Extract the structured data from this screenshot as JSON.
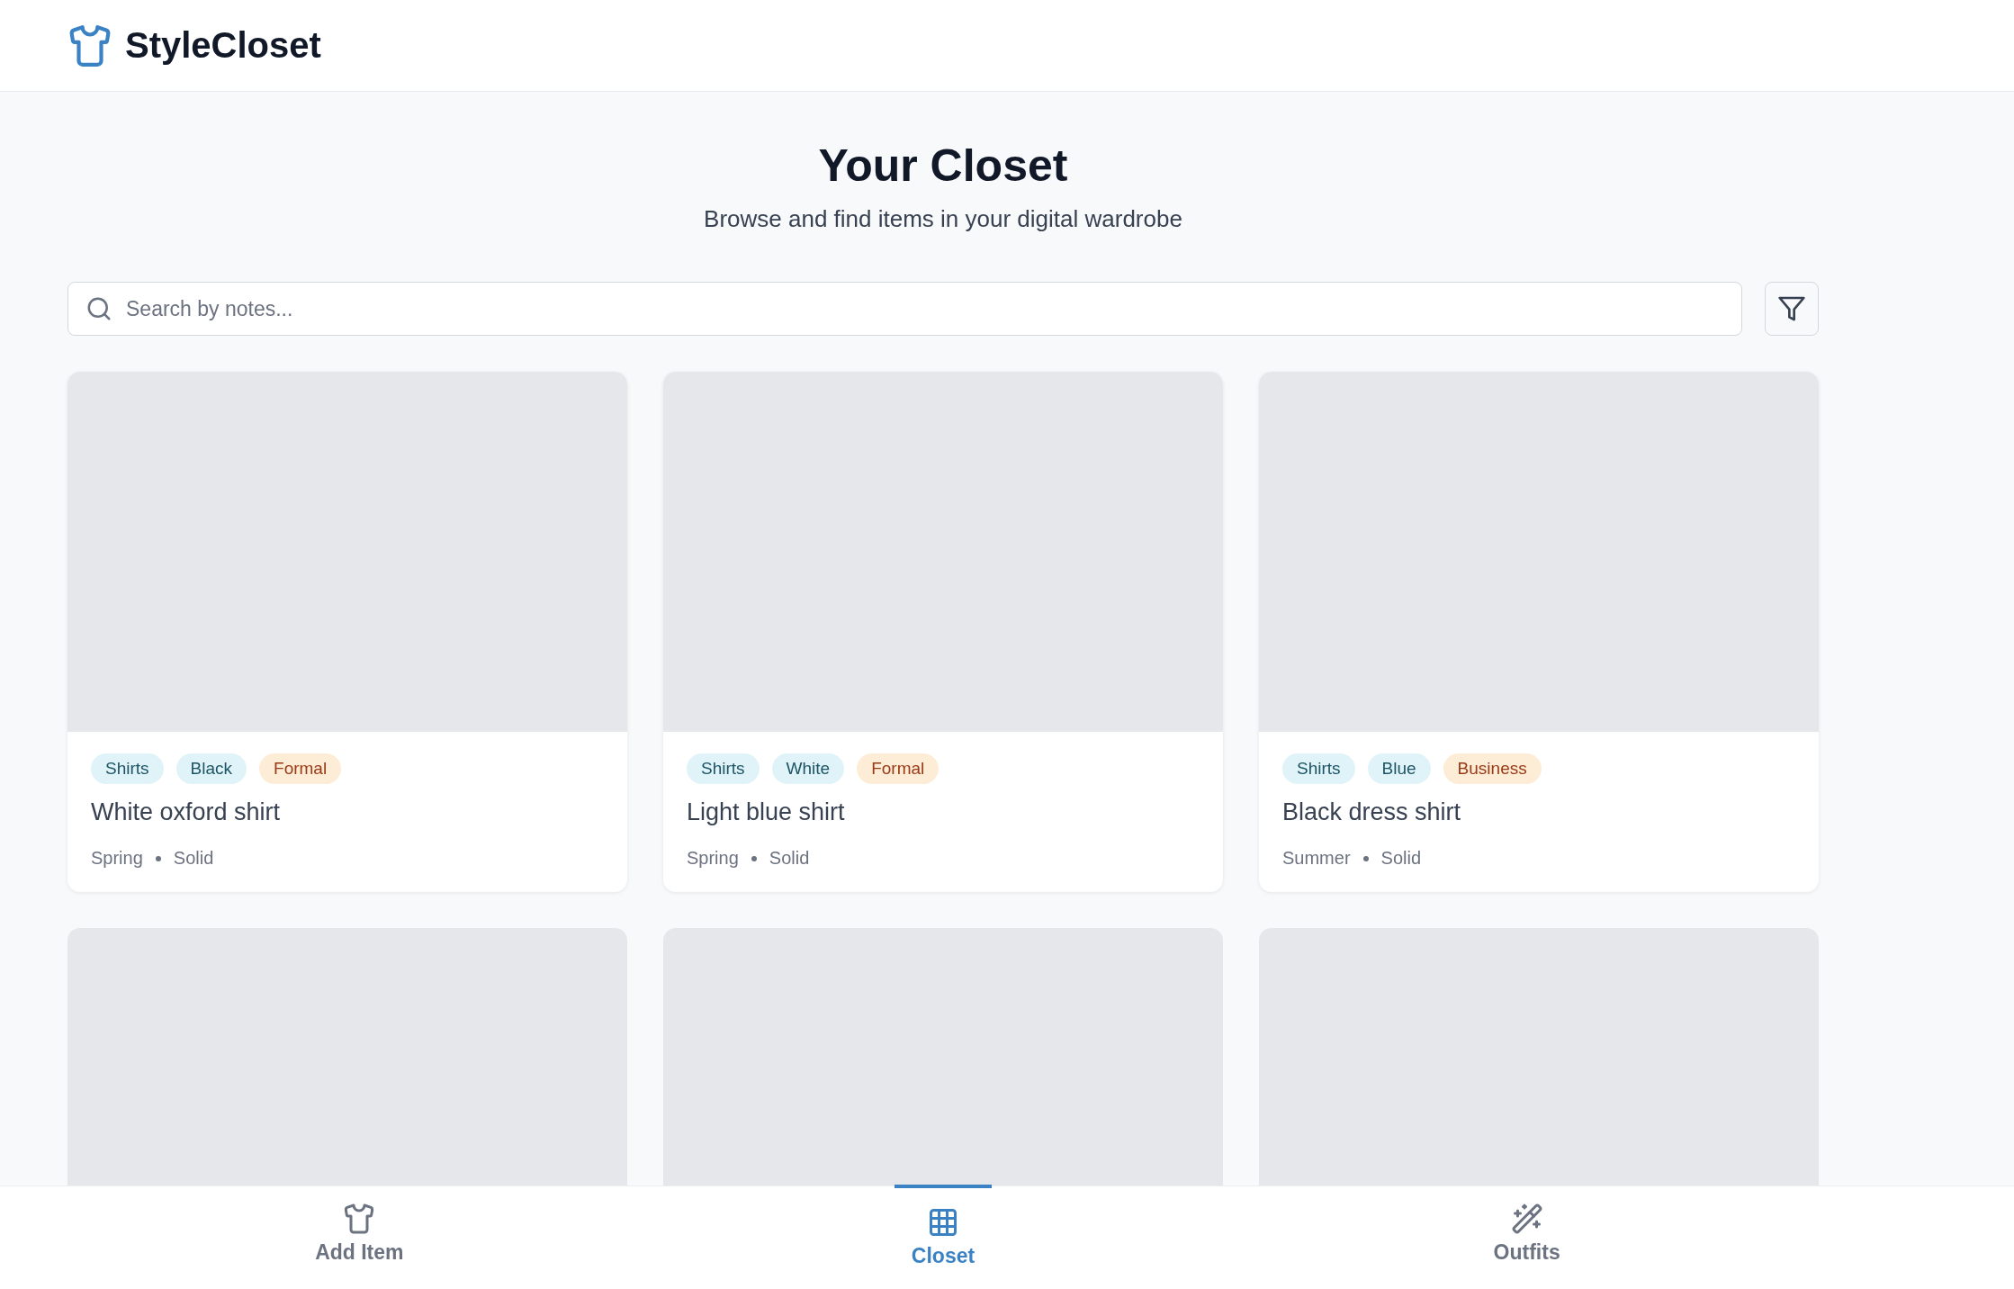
{
  "header": {
    "brand": "StyleCloset"
  },
  "page": {
    "title": "Your Closet",
    "subtitle": "Browse and find items in your digital wardrobe"
  },
  "search": {
    "placeholder": "Search by notes..."
  },
  "items": [
    {
      "tags": [
        {
          "label": "Shirts",
          "kind": "category"
        },
        {
          "label": "Black",
          "kind": "color"
        },
        {
          "label": "Formal",
          "kind": "style"
        }
      ],
      "name": "White oxford shirt",
      "season": "Spring",
      "pattern": "Solid"
    },
    {
      "tags": [
        {
          "label": "Shirts",
          "kind": "category"
        },
        {
          "label": "White",
          "kind": "color"
        },
        {
          "label": "Formal",
          "kind": "style"
        }
      ],
      "name": "Light blue shirt",
      "season": "Spring",
      "pattern": "Solid"
    },
    {
      "tags": [
        {
          "label": "Shirts",
          "kind": "category"
        },
        {
          "label": "Blue",
          "kind": "color"
        },
        {
          "label": "Business",
          "kind": "style"
        }
      ],
      "name": "Black dress shirt",
      "season": "Summer",
      "pattern": "Solid"
    },
    {
      "kind": "picture"
    },
    {
      "kind": "picture"
    },
    {
      "kind": "picture"
    }
  ],
  "nav": [
    {
      "label": "Add Item",
      "selected": false
    },
    {
      "label": "Closet",
      "selected": true
    },
    {
      "label": "Outfits",
      "selected": false
    }
  ]
}
